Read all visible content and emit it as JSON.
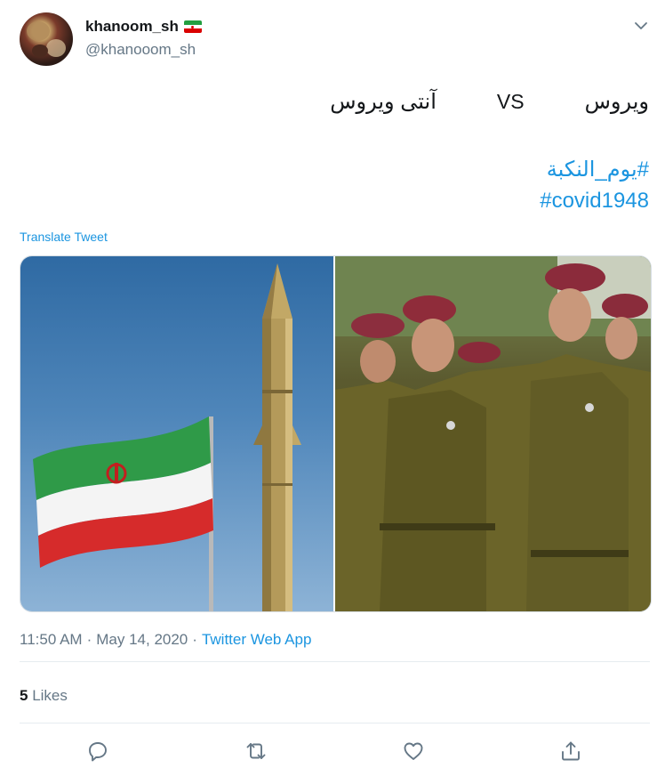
{
  "user": {
    "display_name": "khanoom_sh",
    "handle": "@khanooom_sh",
    "flag_icon": "iran-flag-icon"
  },
  "tweet": {
    "word_virus": "ویروس",
    "vs": "VS",
    "word_antivirus": "آنتی ویروس",
    "hashtag_nakba": "#یوم_النکبة",
    "hashtag_covid": "#covid1948",
    "translate_label": "Translate Tweet"
  },
  "media": {
    "left_image": "iran-flag-and-missile-photo",
    "right_image": "soldiers-crying-photo"
  },
  "meta": {
    "time": "11:50 AM",
    "dot1": "·",
    "date": "May 14, 2020",
    "dot2": "·",
    "source": "Twitter Web App"
  },
  "stats": {
    "likes_count": "5",
    "likes_label": "Likes"
  },
  "actions": {
    "reply_icon": "reply-icon",
    "retweet_icon": "retweet-icon",
    "like_icon": "heart-icon",
    "share_icon": "share-icon"
  },
  "colors": {
    "link": "#1b95e0",
    "secondary_text": "#657786",
    "text": "#14171a",
    "divider": "#e6ecf0"
  }
}
